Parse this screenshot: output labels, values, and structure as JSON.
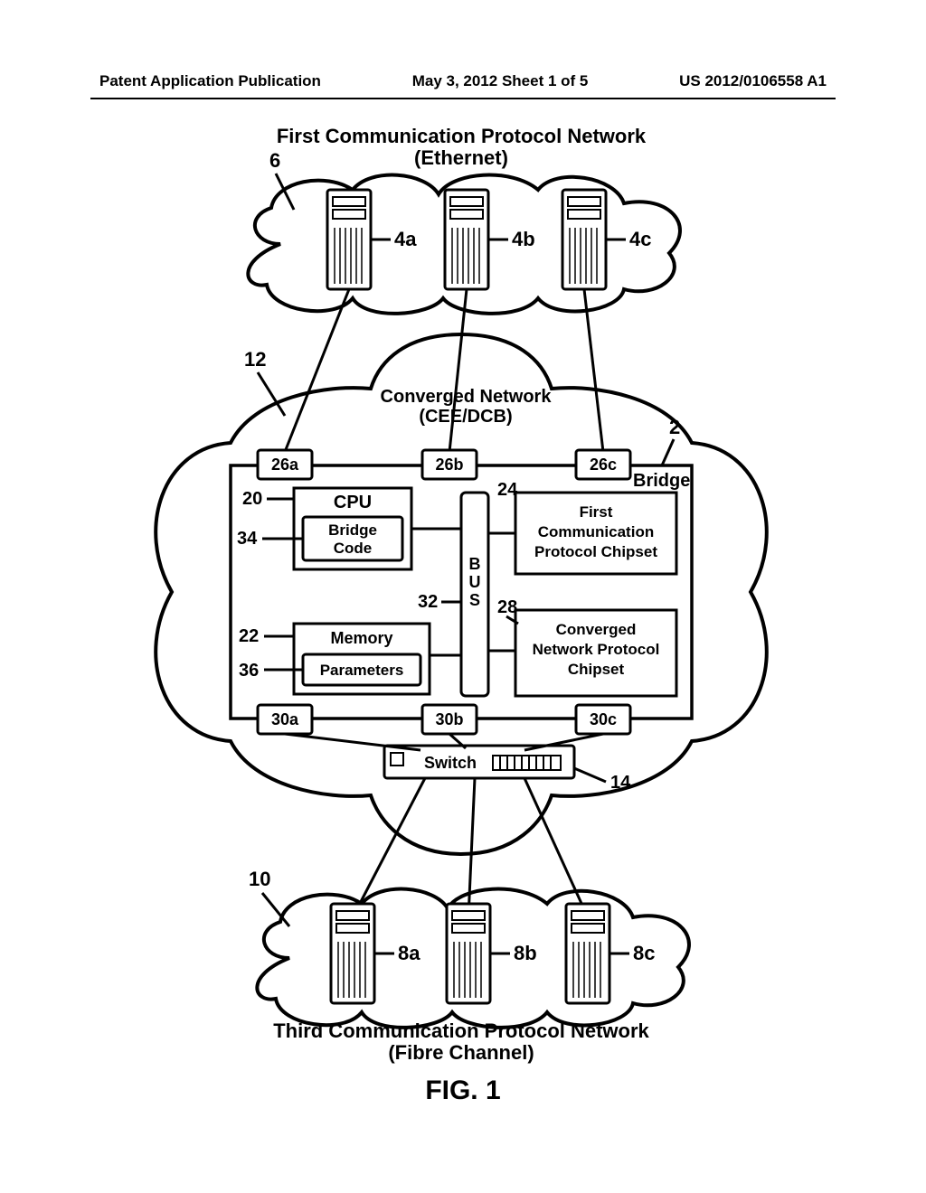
{
  "header": {
    "left": "Patent Application Publication",
    "center": "May 3, 2012   Sheet 1 of 5",
    "right": "US 2012/0106558 A1"
  },
  "figure_label": "FIG. 1",
  "top_network": {
    "title_line1": "First Communication Protocol Network",
    "title_line2": "(Ethernet)",
    "ref": "6",
    "devices": [
      {
        "label": "4a"
      },
      {
        "label": "4b"
      },
      {
        "label": "4c"
      }
    ]
  },
  "converged": {
    "ref": "12",
    "title_line1": "Converged Network",
    "title_line2": "(CEE/DCB)"
  },
  "bridge": {
    "ref": "2",
    "label": "Bridge",
    "ports_top": [
      {
        "label": "26a"
      },
      {
        "label": "26b"
      },
      {
        "label": "26c"
      }
    ],
    "ports_bottom": [
      {
        "label": "30a"
      },
      {
        "label": "30b"
      },
      {
        "label": "30c"
      }
    ],
    "cpu": {
      "ref": "20",
      "label": "CPU"
    },
    "bridge_code": {
      "ref": "34",
      "label1": "Bridge",
      "label2": "Code"
    },
    "memory": {
      "ref": "22",
      "label": "Memory"
    },
    "parameters": {
      "ref": "36",
      "label": "Parameters"
    },
    "bus": {
      "ref": "32",
      "label": "BUS"
    },
    "chipset1": {
      "ref": "24",
      "label1": "First",
      "label2": "Communication",
      "label3": "Protocol Chipset"
    },
    "chipset2": {
      "ref": "28",
      "label1": "Converged",
      "label2": "Network Protocol",
      "label3": "Chipset"
    }
  },
  "switch": {
    "ref": "14",
    "label": "Switch"
  },
  "bottom_network": {
    "title_line1": "Third Communication Protocol Network",
    "title_line2": "(Fibre Channel)",
    "ref": "10",
    "devices": [
      {
        "label": "8a"
      },
      {
        "label": "8b"
      },
      {
        "label": "8c"
      }
    ]
  }
}
